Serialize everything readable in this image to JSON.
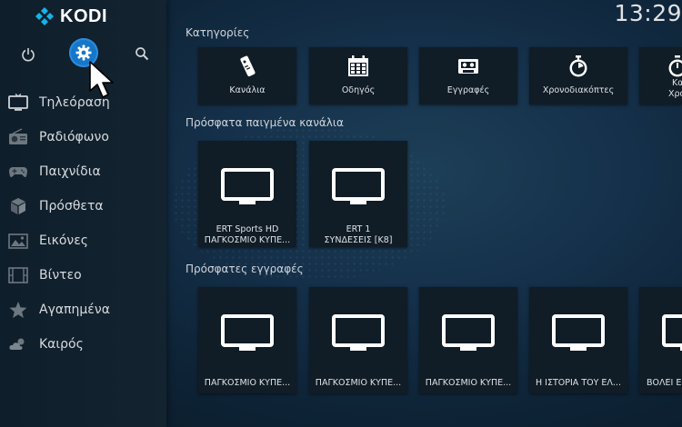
{
  "app": {
    "name": "KODI",
    "clock": "13:29"
  },
  "sidebar": {
    "items": [
      {
        "label": "Τηλεόραση",
        "icon": "tv-icon"
      },
      {
        "label": "Ραδιόφωνο",
        "icon": "radio-icon"
      },
      {
        "label": "Παιχνίδια",
        "icon": "gamepad-icon"
      },
      {
        "label": "Πρόσθετα",
        "icon": "addons-icon"
      },
      {
        "label": "Εικόνες",
        "icon": "pictures-icon"
      },
      {
        "label": "Βίντεο",
        "icon": "video-icon"
      },
      {
        "label": "Αγαπημένα",
        "icon": "star-icon"
      },
      {
        "label": "Καιρός",
        "icon": "weather-icon"
      }
    ],
    "top_icons": [
      "power-icon",
      "settings-gear-icon",
      "search-icon"
    ]
  },
  "sections": {
    "categories": {
      "title": "Κατηγορίες",
      "tiles": [
        {
          "label": "Κανάλια",
          "icon": "remote-icon"
        },
        {
          "label": "Οδηγός",
          "icon": "guide-icon"
        },
        {
          "label": "Εγγραφές",
          "icon": "recordings-icon"
        },
        {
          "label": "Χρονοδιακόπτες",
          "icon": "timer-icon"
        },
        {
          "label_line1": "Κα",
          "label_line2": "Χρον",
          "icon": "timer-rules-icon"
        }
      ]
    },
    "recent_channels": {
      "title": "Πρόσφατα παιγμένα κανάλια",
      "tiles": [
        {
          "line1": "ERT Sports HD",
          "line2": "ΠΑΓΚΟΣΜΙΟ ΚΥΠΕ..."
        },
        {
          "line1": "ERT 1",
          "line2": "ΣΥΝΔΕΣΕΙΣ [K8]"
        }
      ]
    },
    "recent_recordings": {
      "title": "Πρόσφατες εγγραφές",
      "tiles": [
        {
          "label": "ΠΑΓΚΟΣΜΙΟ ΚΥΠΕ..."
        },
        {
          "label": "ΠΑΓΚΟΣΜΙΟ ΚΥΠΕ..."
        },
        {
          "label": "ΠΑΓΚΟΣΜΙΟ ΚΥΠΕ..."
        },
        {
          "label": "Η ΙΣΤΟΡΙΑ ΤΟΥ ΕΛ..."
        },
        {
          "label": "ΒΟΛΕΙ Ε"
        }
      ]
    }
  }
}
